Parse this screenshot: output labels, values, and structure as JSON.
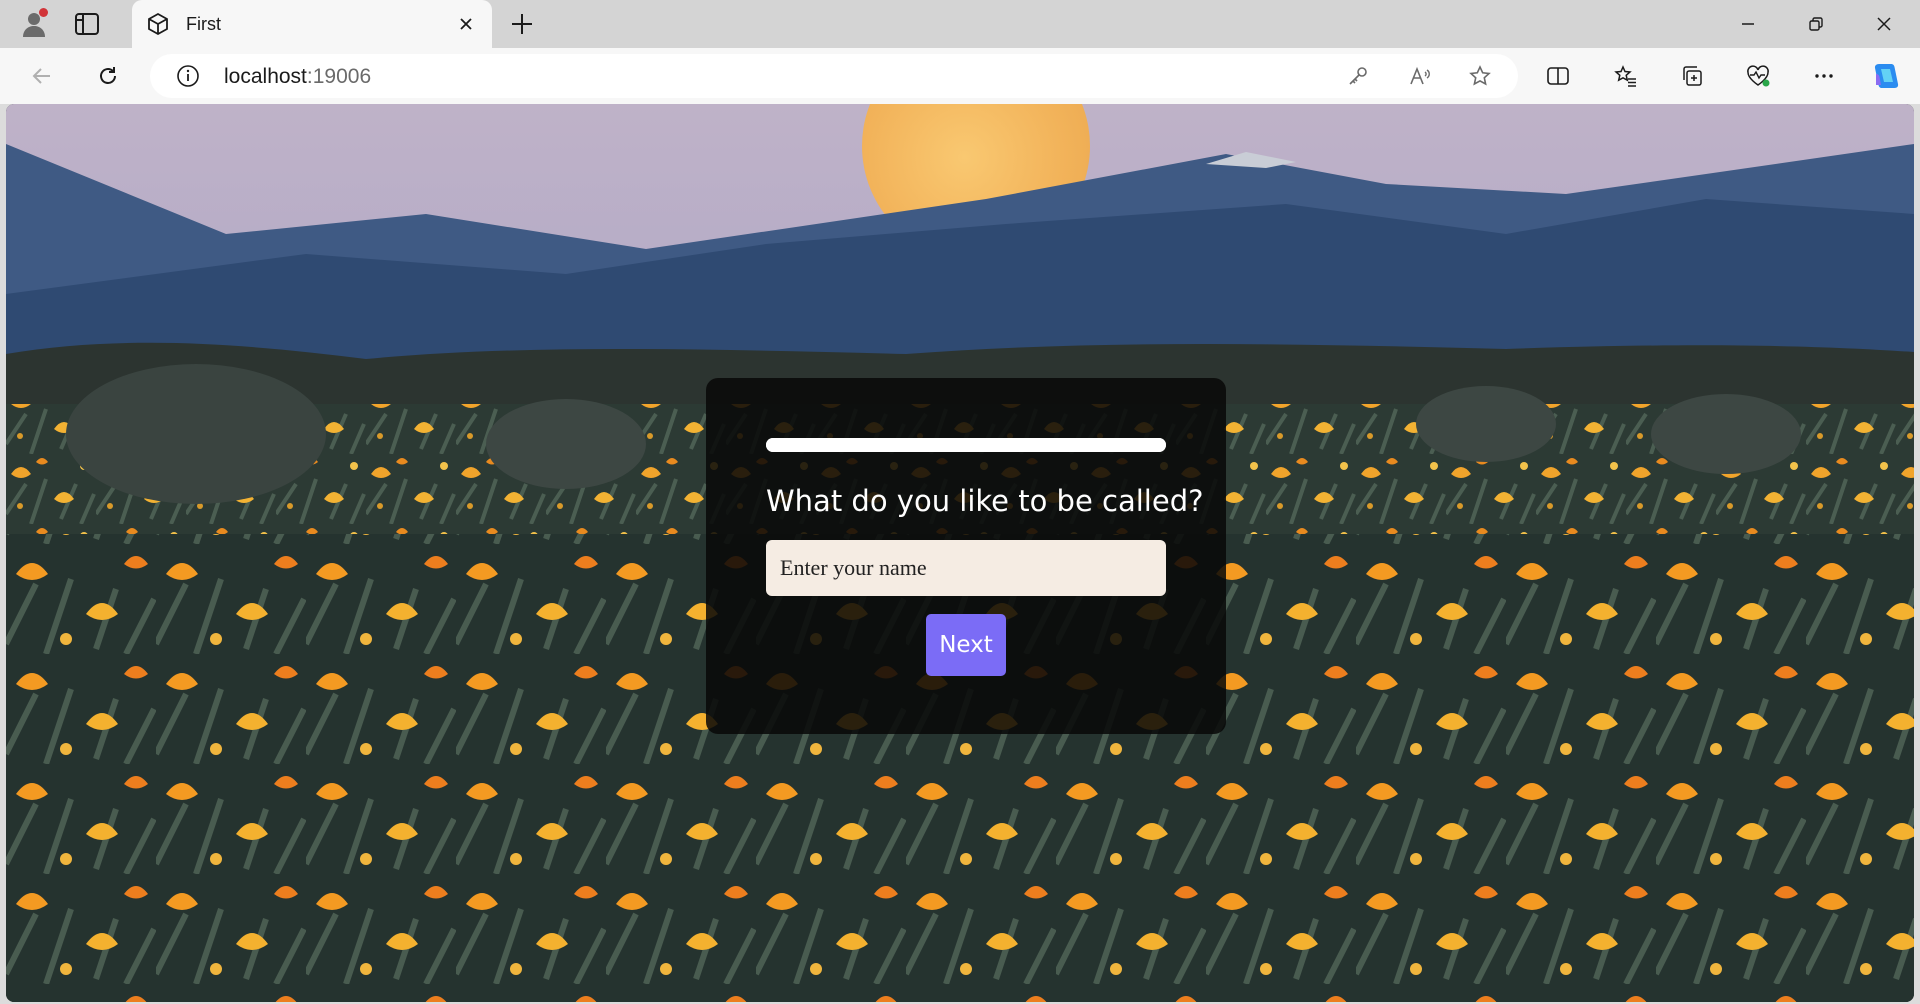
{
  "browser": {
    "tab": {
      "title": "First",
      "favicon": "cube-icon"
    },
    "address": {
      "host": "localhost",
      "port": ":19006"
    }
  },
  "page": {
    "progress_fraction": 1.0,
    "question": "What do you like to be called?",
    "name_input": {
      "placeholder": "Enter your name",
      "value": ""
    },
    "next_label": "Next"
  },
  "colors": {
    "card_bg": "#080808",
    "button": "#7b6cf6",
    "input_bg": "#f5ece3",
    "moon": "#f2b35a"
  }
}
